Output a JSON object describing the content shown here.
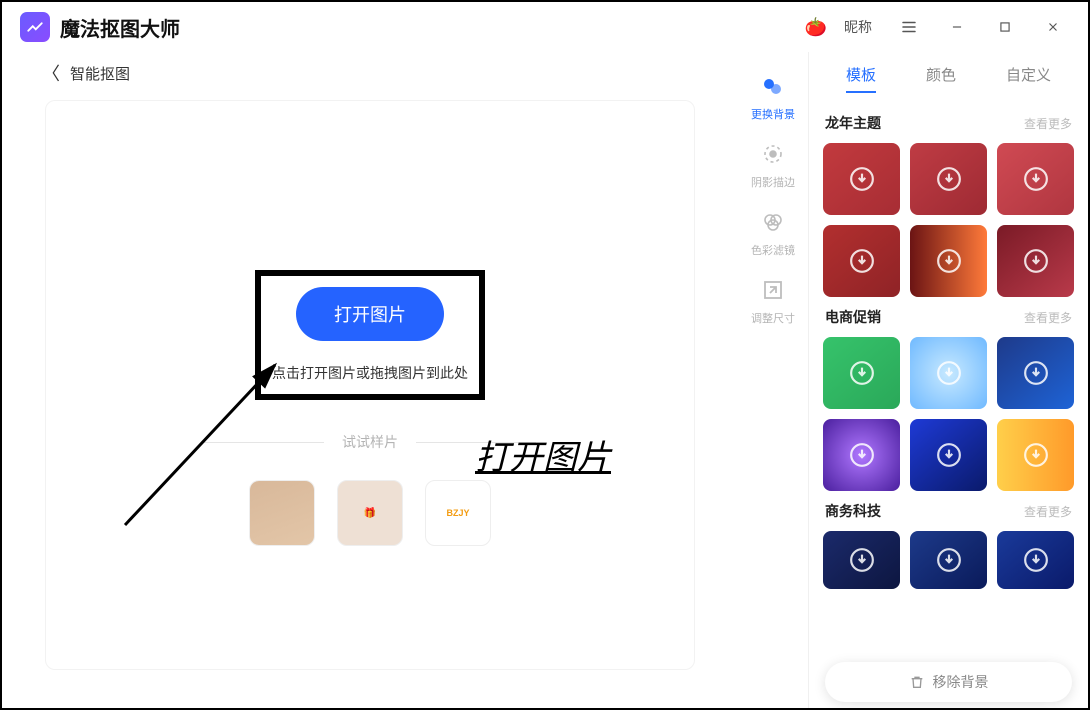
{
  "app": {
    "title": "魔法抠图大师"
  },
  "titlebar": {
    "nickname": "昵称"
  },
  "breadcrumb": {
    "label": "智能抠图"
  },
  "dropzone": {
    "open_label": "打开图片",
    "hint": "点击打开图片或拖拽图片到此处"
  },
  "samples": {
    "heading": "试试样片",
    "thumb3_text": "BZJY"
  },
  "annotation": {
    "text": "打开图片"
  },
  "tools": [
    {
      "label": "更换背景",
      "icon": "swap-bg"
    },
    {
      "label": "阴影描边",
      "icon": "shadow"
    },
    {
      "label": "色彩滤镜",
      "icon": "filter"
    },
    {
      "label": "调整尺寸",
      "icon": "resize"
    }
  ],
  "panel": {
    "tabs": [
      "模板",
      "颜色",
      "自定义"
    ],
    "sections": [
      {
        "title": "龙年主题",
        "more": "查看更多"
      },
      {
        "title": "电商促销",
        "more": "查看更多"
      },
      {
        "title": "商务科技",
        "more": "查看更多"
      }
    ],
    "remove_bg": "移除背景"
  }
}
